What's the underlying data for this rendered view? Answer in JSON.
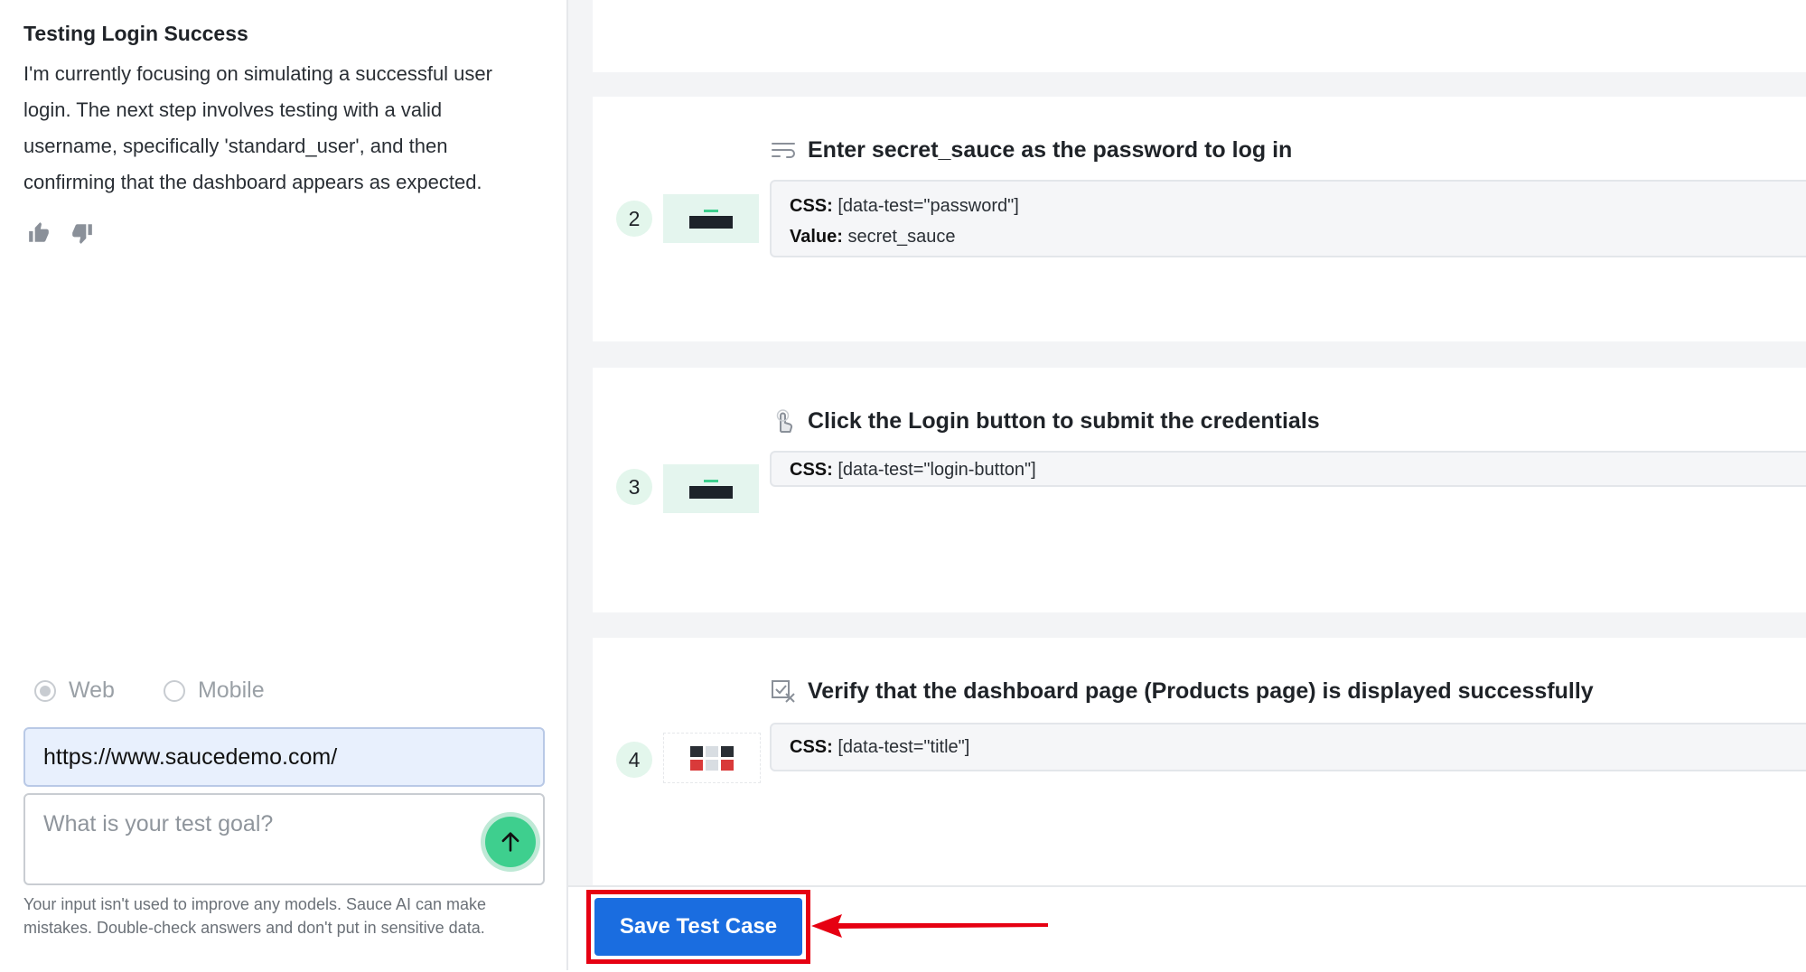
{
  "chat": {
    "title": "Testing Login Success",
    "body": "I'm currently focusing on simulating a successful user login. The next step involves testing with a valid username, specifically 'standard_user', and then confirming that the dashboard appears as expected."
  },
  "platform": {
    "options": [
      {
        "label": "Web",
        "selected": true
      },
      {
        "label": "Mobile",
        "selected": false
      }
    ]
  },
  "inputs": {
    "url_value": "https://www.saucedemo.com/",
    "goal_placeholder": "What is your test goal?"
  },
  "disclaimer": "Your input isn't used to improve any models. Sauce AI can make mistakes. Double-check answers and don't put in sensitive data.",
  "steps": [
    {
      "number": "2",
      "icon": "type-text-icon",
      "title": "Enter secret_sauce as the password to log in",
      "css_label": "CSS:",
      "css_value": "[data-test=\"password\"]",
      "value_label": "Value:",
      "value": "secret_sauce"
    },
    {
      "number": "3",
      "icon": "tap-icon",
      "title": "Click the Login button to submit the credentials",
      "css_label": "CSS:",
      "css_value": "[data-test=\"login-button\"]"
    },
    {
      "number": "4",
      "icon": "verify-icon",
      "title": "Verify that the dashboard page (Products page) is displayed successfully",
      "css_label": "CSS:",
      "css_value": "[data-test=\"title\"]"
    }
  ],
  "footer": {
    "save_label": "Save Test Case"
  },
  "colors": {
    "accent_green": "#3ecf8e",
    "primary_blue": "#1a6de0",
    "highlight_red": "#e60012"
  }
}
